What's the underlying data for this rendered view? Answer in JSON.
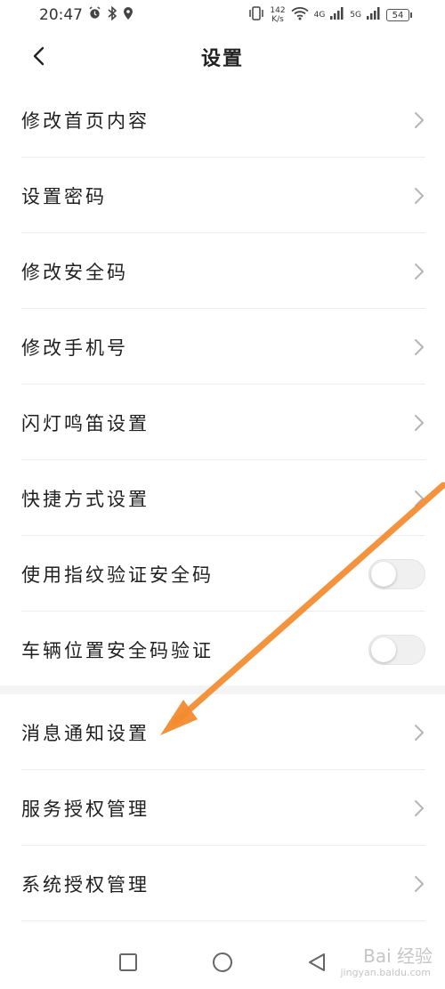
{
  "status": {
    "time": "20:47",
    "speed_value": "142",
    "speed_unit": "K/s",
    "net1": "4G",
    "net2": "5G",
    "battery": "54"
  },
  "header": {
    "title": "设置"
  },
  "settings": {
    "items": [
      {
        "label": "修改首页内容"
      },
      {
        "label": "设置密码"
      },
      {
        "label": "修改安全码"
      },
      {
        "label": "修改手机号"
      },
      {
        "label": "闪灯鸣笛设置"
      },
      {
        "label": "快捷方式设置"
      },
      {
        "label": "使用指纹验证安全码",
        "toggle": false
      },
      {
        "label": "车辆位置安全码验证",
        "toggle": false
      },
      {
        "label": "消息通知设置"
      },
      {
        "label": "服务授权管理"
      },
      {
        "label": "系统授权管理"
      }
    ]
  },
  "watermark": {
    "text": "Bai 经验",
    "sub": "jingyan.baidu.com"
  },
  "colors": {
    "arrow": "#F28A2E",
    "toggle_track": "#f0f0f0",
    "divider": "#eeeeee"
  },
  "icons": [
    "alarm-icon",
    "bluetooth-icon",
    "location-icon",
    "vibrate-icon",
    "wifi-icon",
    "signal-icon",
    "battery-icon",
    "chevron-right-icon",
    "back-arrow-icon",
    "square-nav-icon",
    "circle-nav-icon",
    "triangle-back-icon"
  ]
}
